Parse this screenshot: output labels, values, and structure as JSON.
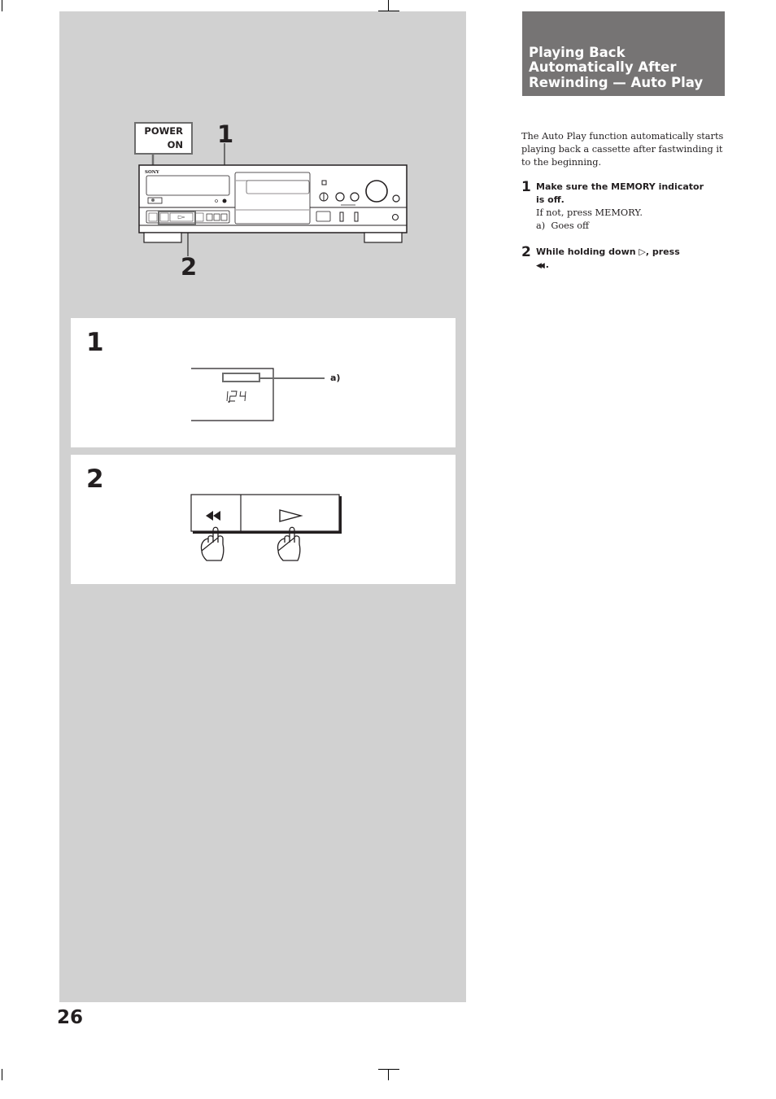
{
  "page": {
    "number": "26"
  },
  "section": {
    "title": "Playing Back\nAutomatically After\nRewinding — Auto Play",
    "intro": "The Auto Play function automatically starts playing back a cassette after fastwinding it to the beginning.",
    "steps": [
      {
        "number": "1",
        "heading_line1": "Make sure the MEMORY indicator",
        "heading_line2": "is off.",
        "detail": "If not, press MEMORY.",
        "note": "a)  Goes off"
      },
      {
        "number": "2",
        "heading_prefix": "While holding down",
        "play_symbol": "▷",
        "heading_middle": ", press",
        "rewind_symbol": "◀◀",
        "heading_suffix": "."
      }
    ]
  },
  "illustration": {
    "callout_1": "1",
    "callout_2": "2",
    "power_label_line1": "POWER",
    "power_label_line2": "ON",
    "brand": "SONY",
    "icons": [
      "cassette-deck",
      "power-button",
      "play-button",
      "rewind-button",
      "pointing-hand"
    ]
  },
  "step_boxes": [
    {
      "number": "1",
      "display_counter": "1.24",
      "callout_label": "a)"
    },
    {
      "number": "2",
      "rewind_icon": "rewind-icon",
      "play_icon": "play-icon"
    }
  ]
}
